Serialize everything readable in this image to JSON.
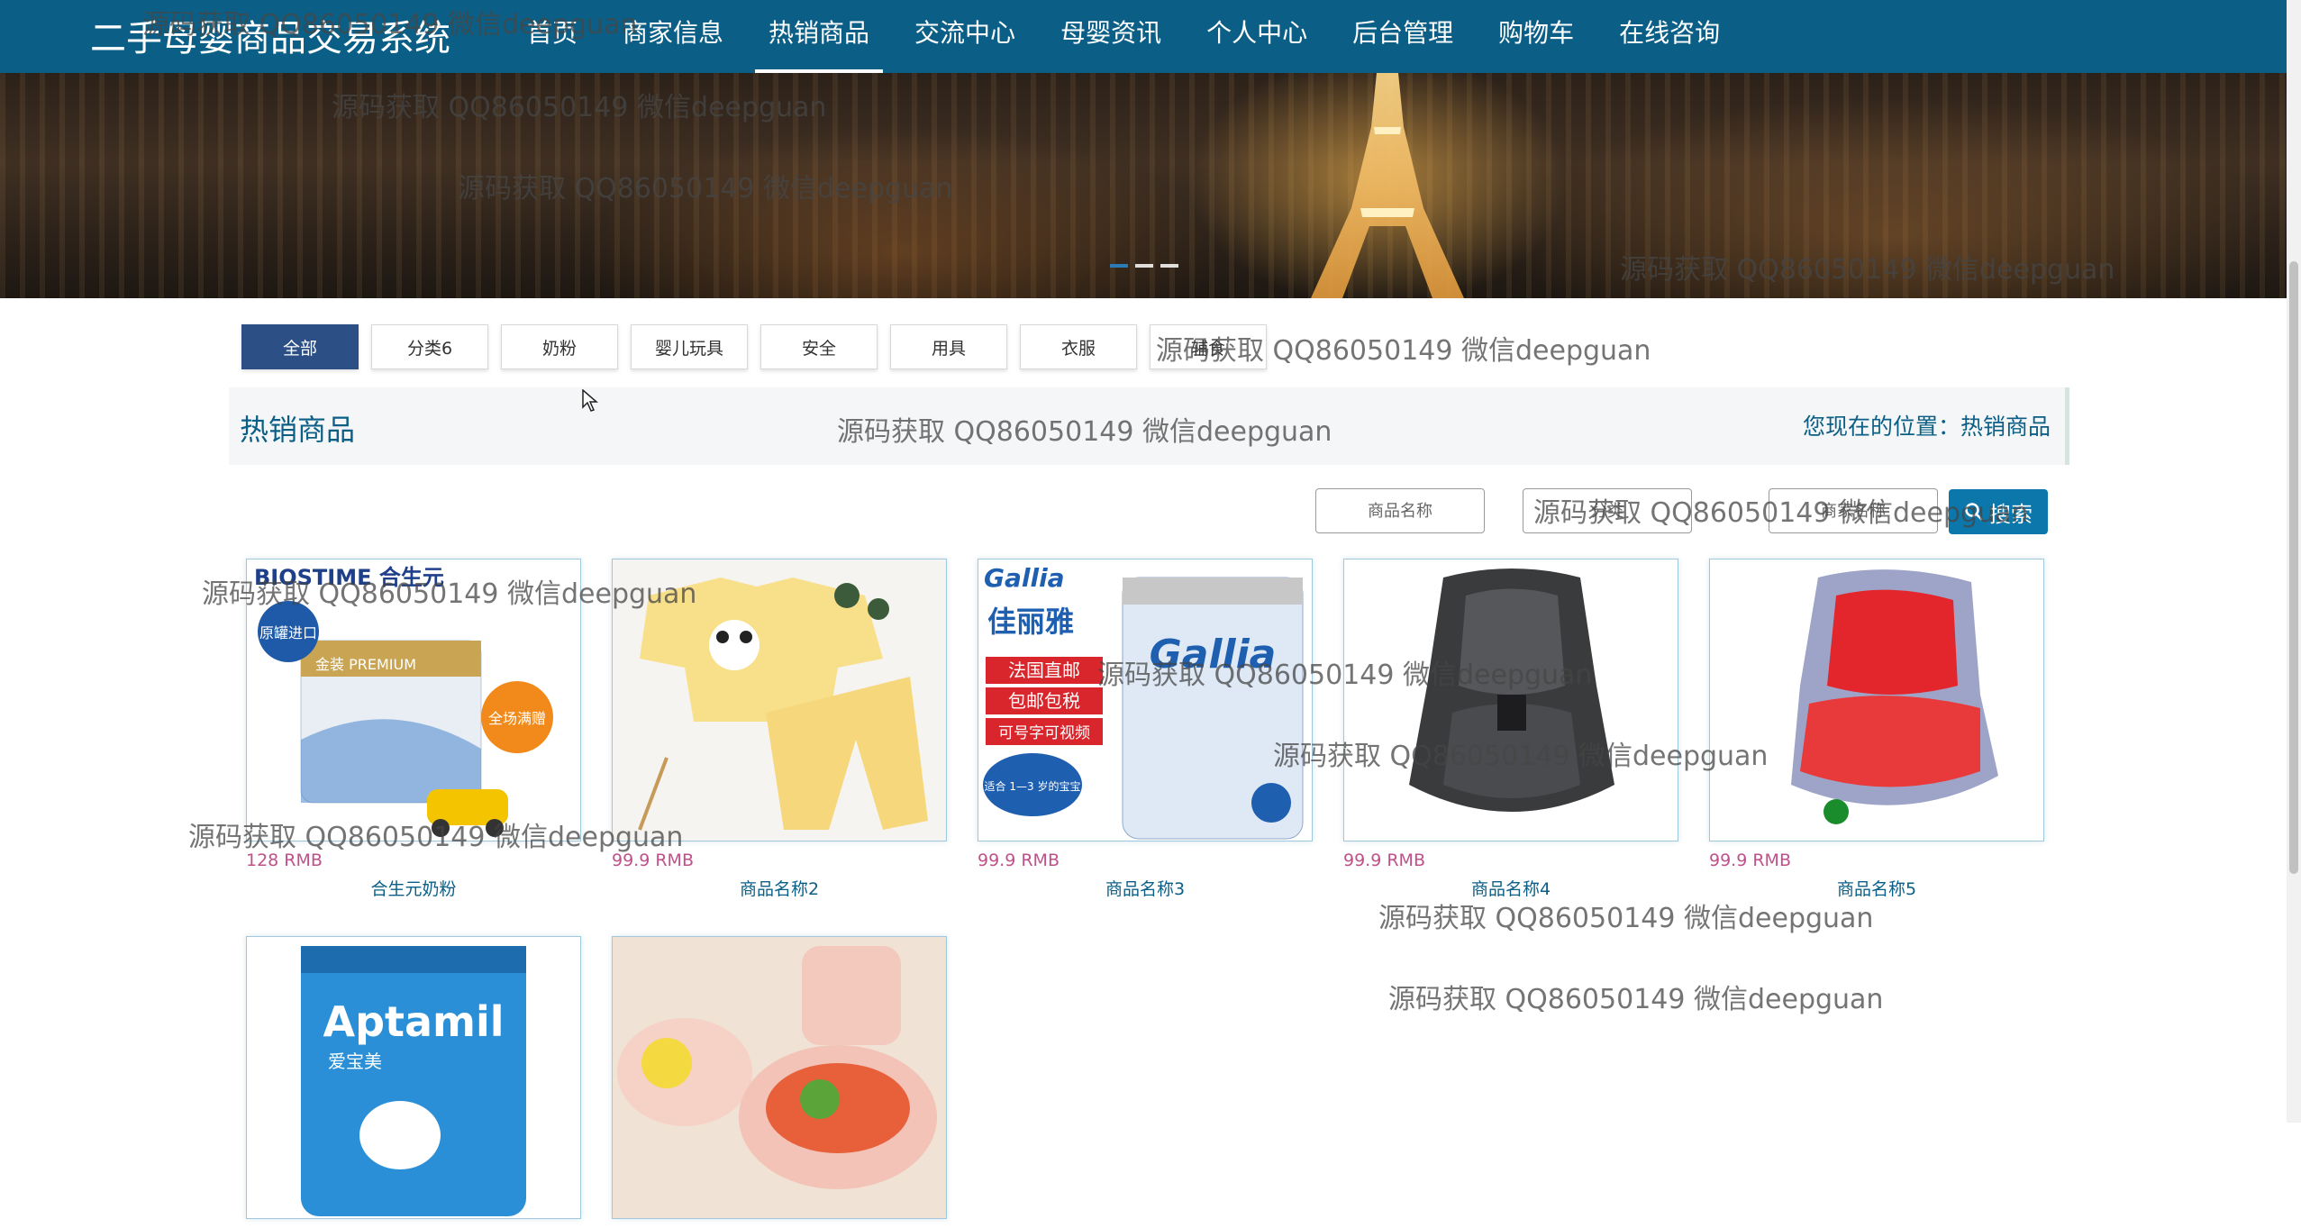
{
  "nav": {
    "logo": "二手母婴商品交易系统",
    "items": [
      "首页",
      "商家信息",
      "热销商品",
      "交流中心",
      "母婴资讯",
      "个人中心",
      "后台管理",
      "购物车",
      "在线咨询"
    ],
    "active_index": 2
  },
  "categories": [
    "全部",
    "分类6",
    "奶粉",
    "婴儿玩具",
    "安全",
    "用具",
    "衣服",
    "辅食"
  ],
  "section": {
    "title": "热销商品",
    "location_prefix": "您现在的位置：",
    "location_current": "热销商品"
  },
  "search": {
    "field1_placeholder": "商品名称",
    "field2_placeholder": "分类",
    "field3_placeholder": "商家名称",
    "button_label": "搜索"
  },
  "products": [
    {
      "price": "128 RMB",
      "name": "合生元奶粉"
    },
    {
      "price": "99.9 RMB",
      "name": "商品名称2"
    },
    {
      "price": "99.9 RMB",
      "name": "商品名称3"
    },
    {
      "price": "99.9 RMB",
      "name": "商品名称4"
    },
    {
      "price": "99.9 RMB",
      "name": "商品名称5"
    },
    {
      "price": "",
      "name": ""
    },
    {
      "price": "",
      "name": ""
    }
  ],
  "product_images": {
    "p1_brand": "BIOSTIME 合生元",
    "p1_badge1": "原罐进口",
    "p1_badge2": "全场满赠",
    "p1_tag": "金装 PREMIUM",
    "p3_brand": "Gallia",
    "p3_cn": "佳丽雅",
    "p3_promo1": "法国直邮",
    "p3_promo2": "包邮包税",
    "p3_promo3": "可号字可视频",
    "p3_age": "适合 1—3 岁的宝宝",
    "p3_can": "Gallia",
    "p6_brand": "Aptamil",
    "p6_cn": "爱宝美"
  },
  "watermark": "源码获取 QQ86050149 微信deepguan",
  "colors": {
    "nav_bg": "#0b5f86",
    "active_category_bg": "#2c4f86",
    "price": "#c0508a",
    "search_button": "#0b77ab"
  }
}
